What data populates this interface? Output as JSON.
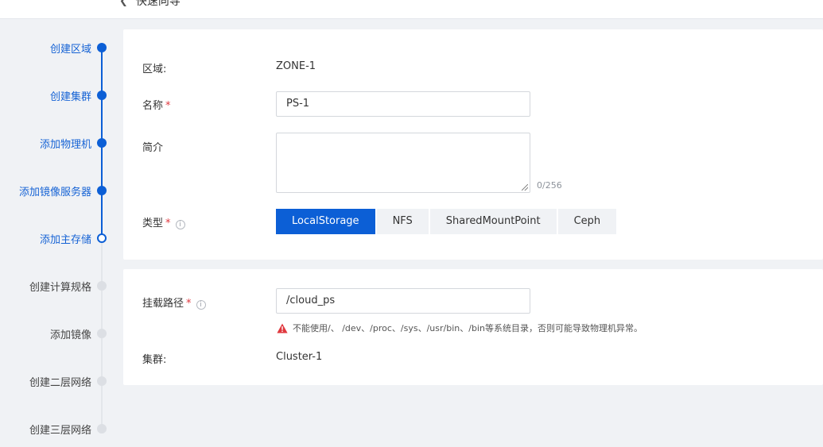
{
  "header": {
    "back_label": "快速向导"
  },
  "steps": [
    {
      "label": "创建区域",
      "state": "done"
    },
    {
      "label": "创建集群",
      "state": "done"
    },
    {
      "label": "添加物理机",
      "state": "done"
    },
    {
      "label": "添加镜像服务器",
      "state": "done"
    },
    {
      "label": "添加主存储",
      "state": "current"
    },
    {
      "label": "创建计算规格",
      "state": "todo"
    },
    {
      "label": "添加镜像",
      "state": "todo"
    },
    {
      "label": "创建二层网络",
      "state": "todo"
    },
    {
      "label": "创建三层网络",
      "state": "todo"
    }
  ],
  "form": {
    "zone_label": "区域:",
    "zone_value": "ZONE-1",
    "name_label": "名称",
    "name_value": "PS-1",
    "desc_label": "简介",
    "desc_value": "",
    "desc_counter": "0/256",
    "type_label": "类型",
    "type_options": [
      "LocalStorage",
      "NFS",
      "SharedMountPoint",
      "Ceph"
    ],
    "type_selected": "LocalStorage",
    "required_mark": "*",
    "info_mark": "i"
  },
  "mount": {
    "path_label": "挂载路径",
    "path_value": "/cloud_ps",
    "warning": "不能使用/、 /dev、/proc、/sys、/usr/bin、/bin等系统目录，否则可能导致物理机异常。",
    "cluster_label": "集群:",
    "cluster_value": "Cluster-1"
  },
  "colors": {
    "accent": "#0c5fd6",
    "required": "#e0383e",
    "warning": "#e0383e"
  }
}
